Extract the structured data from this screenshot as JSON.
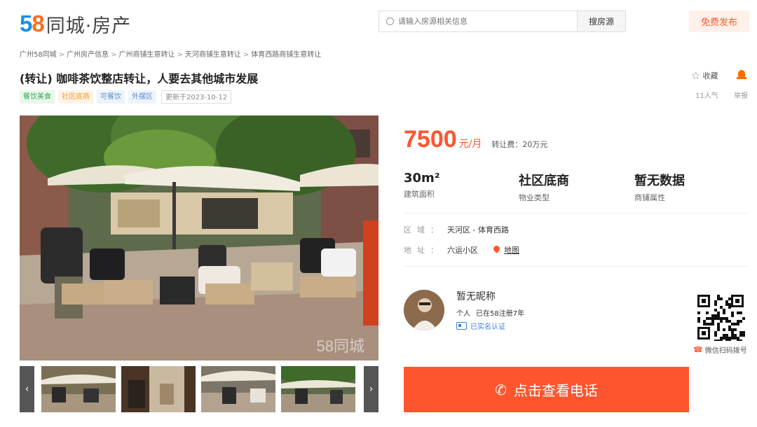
{
  "header": {
    "logo_num_5": "5",
    "logo_num_8": "8",
    "logo_text": "同城·房产",
    "search_placeholder": "请输入房源相关信息",
    "search_button": "搜房源",
    "publish_button": "免费发布"
  },
  "breadcrumb": [
    "广州58同城",
    "广州房产信息",
    "广州商铺生意转让",
    "天河商铺生意转让",
    "体育西路商铺生意转让"
  ],
  "listing": {
    "title": "(转让) 咖啡茶饮整店转让，人要去其他城市发展",
    "tags": [
      {
        "label": "餐饮美食",
        "color": "green"
      },
      {
        "label": "社区底商",
        "color": "orange"
      },
      {
        "label": "可餐饮",
        "color": "blue"
      },
      {
        "label": "外摆区",
        "color": "blue"
      }
    ],
    "updated": "更新于2023-10-12",
    "collect_label": "收藏",
    "popularity": "11人气",
    "report_label": "举报"
  },
  "gallery": {
    "watermark": "58同城",
    "prev": "‹",
    "next": "›"
  },
  "price": {
    "value": "7500",
    "unit": "元/月",
    "transfer_fee": "转让费：20万元"
  },
  "stats": [
    {
      "value": "30m²",
      "label": "建筑面积"
    },
    {
      "value": "社区底商",
      "label": "物业类型"
    },
    {
      "value": "暂无数据",
      "label": "商铺属性"
    }
  ],
  "location": {
    "region_key": "区域：",
    "region_value": "天河区 - 体育西路",
    "address_key": "地址：",
    "address_value": "六运小区",
    "map_link": "地图"
  },
  "agent": {
    "name": "暂无昵称",
    "type": "个人",
    "registered": "已在58注册7年",
    "verified": "已实名认证",
    "qr_tip": "微信扫码拨号"
  },
  "cta": {
    "call_label": "点击查看电话"
  },
  "colors": {
    "accent": "#ff552e",
    "brand_blue": "#1b8fe6",
    "brand_orange": "#ff6d1f"
  }
}
